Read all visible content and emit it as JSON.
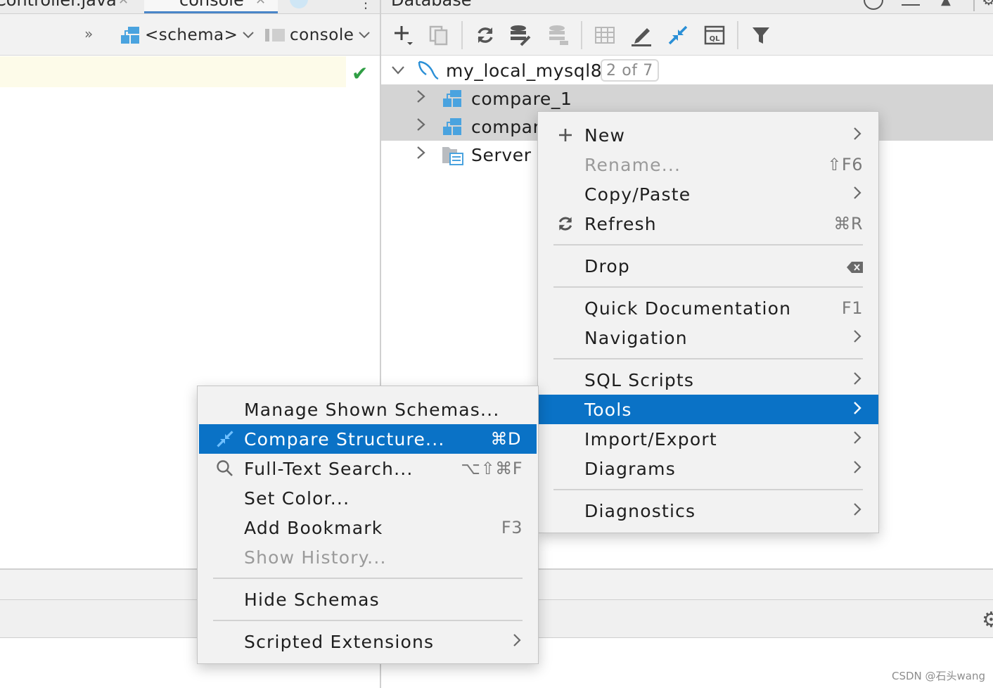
{
  "editor_tabs": {
    "tab1": "Controller.java",
    "tab2": "console"
  },
  "db_panel_title": "Database",
  "editor_toolbar": {
    "more": "»",
    "schema_selector": "<schema>",
    "console_selector": "console"
  },
  "tree": {
    "root_label": "my_local_mysql8",
    "root_badge": "2 of 7",
    "children": [
      {
        "label": "compare_1"
      },
      {
        "label": "compar"
      },
      {
        "label": "Server"
      }
    ]
  },
  "context_menu": {
    "items": [
      {
        "label": "New",
        "shortcut": "",
        "submenu": true
      },
      {
        "label": "Rename...",
        "shortcut": "⇧F6",
        "disabled": true
      },
      {
        "label": "Copy/Paste",
        "shortcut": "",
        "submenu": true
      },
      {
        "label": "Refresh",
        "shortcut": "⌘R"
      },
      {
        "label": "Drop",
        "shortcut": ""
      },
      {
        "label": "Quick Documentation",
        "shortcut": "F1"
      },
      {
        "label": "Navigation",
        "submenu": true
      },
      {
        "label": "SQL Scripts",
        "submenu": true
      },
      {
        "label": "Tools",
        "submenu": true,
        "highlighted": true
      },
      {
        "label": "Import/Export",
        "submenu": true
      },
      {
        "label": "Diagrams",
        "submenu": true
      },
      {
        "label": "Diagnostics",
        "submenu": true
      }
    ]
  },
  "tools_submenu": {
    "items": [
      {
        "label": "Manage Shown Schemas..."
      },
      {
        "label": "Compare Structure...",
        "shortcut": "⌘D",
        "highlighted": true
      },
      {
        "label": "Full-Text Search...",
        "shortcut": "⌥⇧⌘F"
      },
      {
        "label": "Set Color..."
      },
      {
        "label": "Add Bookmark",
        "shortcut": "F3"
      },
      {
        "label": "Show History...",
        "disabled": true
      },
      {
        "label": "Hide Schemas"
      },
      {
        "label": "Scripted Extensions",
        "submenu": true
      }
    ]
  },
  "watermark": "CSDN @石头wang",
  "colors": {
    "highlight": "#0a72c6",
    "accent_icon": "#2a8fd6",
    "selection_row": "#d4d4d4",
    "check": "#2f9e44"
  }
}
